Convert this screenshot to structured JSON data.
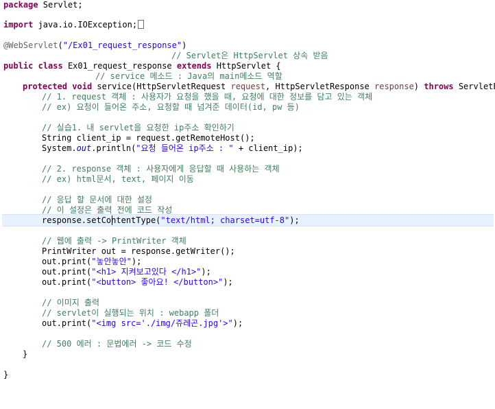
{
  "editor": {
    "lines": {
      "l1_kw": "package",
      "l1_rest": " Servlet;",
      "l3_kw": "import",
      "l3_rest": " java.io.IOException;",
      "l5_ann": "@WebServlet",
      "l5_p1": "(",
      "l5_str": "\"/Ex01_request_response\"",
      "l5_p2": ")",
      "l6_cm": "// Servlet은 HttpServlet 상속 받음",
      "l7_kw1": "public",
      "l7_kw2": "class",
      "l7_name": " Ex01_request_response ",
      "l7_kw3": "extends",
      "l7_rest": " HttpServlet {",
      "l8_cm": "// service 메소드 : Java의 main메소드 역할",
      "l9_kw1": "protected",
      "l9_kw2": "void",
      "l9_a": " service(HttpServletRequest ",
      "l9_p1": "request",
      "l9_b": ", HttpServletResponse ",
      "l9_p2": "response",
      "l9_c": ") ",
      "l9_kw3": "throws",
      "l9_d": " ServletExc",
      "l10_cm": "// 1. request 객체 : 사용자가 요청을 했을 때, 요청에 대한 정보를 담고 있는 객체",
      "l11_cm": "// ex) 요청이 들어온 주소, 요청할 때 넘겨준 데이터(id, pw 등)",
      "l13_cm": "// 실습1. 내 servlet을 요청한 ip주소 확인하기",
      "l14_code": "String client_ip = request.getRemoteHost();",
      "l15_a": "System.",
      "l15_fld": "out",
      "l15_b": ".println(",
      "l15_str": "\"요청 들어온 ip주소 : \"",
      "l15_c": " + client_ip);",
      "l17_cm": "// 2. response 객체 : 사용자에게 응답할 때 사용하는 객체",
      "l18_cm": "// ex) html문서, text, 페이지 이동",
      "l20_cm": "// 응답 할 문서에 대한 설정",
      "l21_cm": "// 이 설정은 출력 전에 코드 작성",
      "l22_a": "response.setContentType(",
      "l22_str": "\"text/html; charset=utf-8\"",
      "l22_b": ");",
      "l24_cm": "// 웹에 출력 -> PrintWriter 객체",
      "l25_code": "PrintWriter out = response.getWriter();",
      "l26_a": "out.print(",
      "l26_str": "\"놓안놓안\"",
      "l26_b": ");",
      "l27_a": "out.print(",
      "l27_str": "\"<h1> 지켜보고있다 </h1>\"",
      "l27_b": ");",
      "l28_a": "out.print(",
      "l28_str": "\"<button> 좋아요! </button>\"",
      "l28_b": ");",
      "l30_cm": "// 이미지 출력",
      "l31_cm": "// servlet이 실행되는 위치 : webapp 폴더",
      "l32_a": "out.print(",
      "l32_str": "\"<img src='./img/쥬레곤.jpg'>\"",
      "l32_b": ");",
      "l34_cm": "// 500 에러 : 문법에러 -> 코드 수정",
      "l35_code": "}",
      "l37_code": "}"
    }
  }
}
